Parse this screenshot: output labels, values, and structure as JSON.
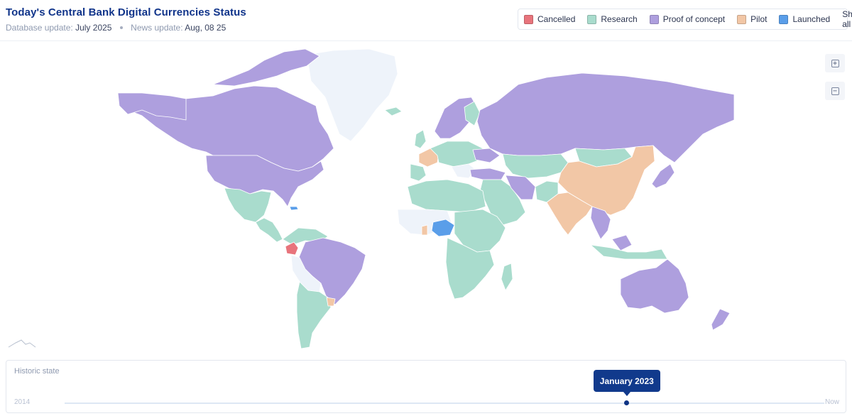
{
  "header": {
    "title": "Today's Central Bank Digital Currencies Status",
    "database_update_label": "Database update:",
    "database_update_value": "July 2025",
    "news_update_label": "News update:",
    "news_update_value": "Aug, 08 25"
  },
  "legend": {
    "items": [
      {
        "label": "Cancelled",
        "color": "#e8747c"
      },
      {
        "label": "Research",
        "color": "#a9dccd"
      },
      {
        "label": "Proof of concept",
        "color": "#ae9fde"
      },
      {
        "label": "Pilot",
        "color": "#f2c7a6"
      },
      {
        "label": "Launched",
        "color": "#5a9ee9"
      }
    ],
    "show_all_label": "Show all"
  },
  "map": {
    "colors": {
      "cancelled": "#e8747c",
      "research": "#a9dccd",
      "proof_of_concept": "#ae9fde",
      "pilot": "#f2c7a6",
      "launched": "#5a9ee9",
      "no_data": "#eef3fa",
      "border": "#ffffff"
    },
    "zoom_in_icon": "plus-square-icon",
    "zoom_out_icon": "minus-square-icon"
  },
  "timeline": {
    "label": "Historic state",
    "start_label": "2014",
    "end_label": "Now",
    "current_label": "January 2023",
    "position": 0.74
  }
}
